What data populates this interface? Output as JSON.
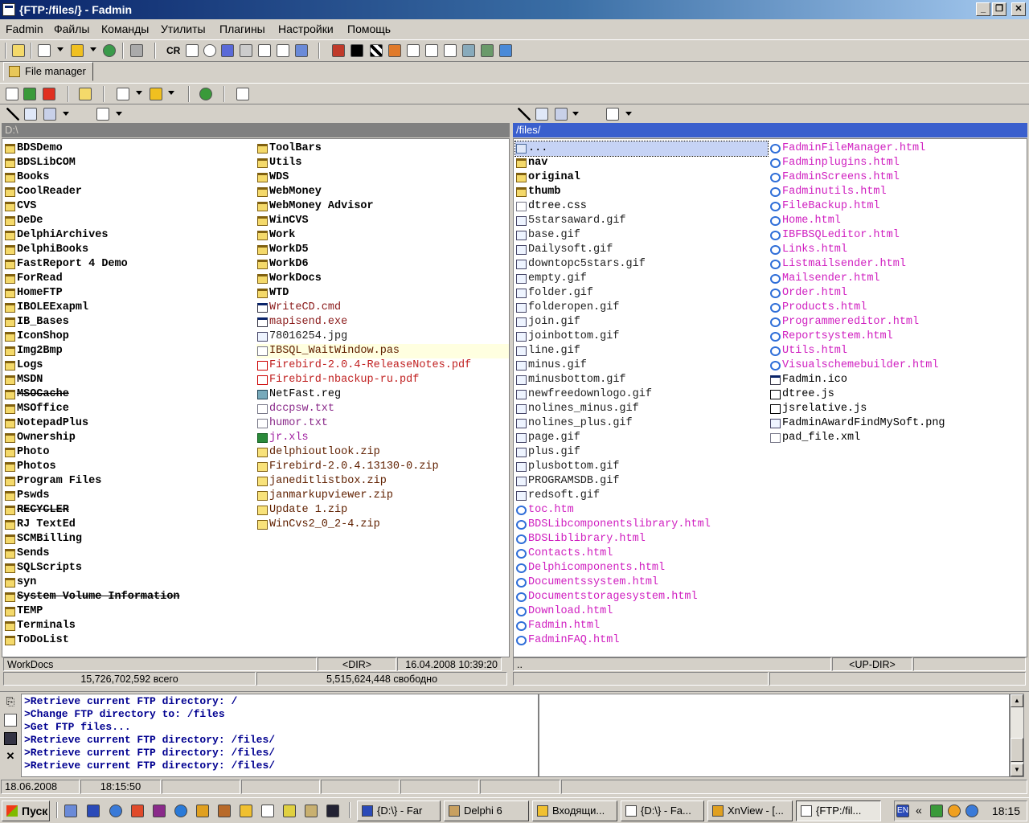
{
  "window": {
    "title": "{FTP:/files/} - Fadmin",
    "btn_min": "_",
    "btn_max": "❐",
    "btn_close": "✕"
  },
  "menu": [
    "Fadmin",
    "Файлы",
    "Команды",
    "Утилиты",
    "Плагины",
    "Настройки",
    "Помощь"
  ],
  "toolbar": {
    "cr_label": "CR"
  },
  "tab": {
    "label": "File manager"
  },
  "left": {
    "path": "D:\\",
    "col1": [
      {
        "n": "BDSDemo",
        "t": "dir"
      },
      {
        "n": "BDSLibCOM",
        "t": "dir"
      },
      {
        "n": "Books",
        "t": "dir"
      },
      {
        "n": "CoolReader",
        "t": "dir"
      },
      {
        "n": "CVS",
        "t": "dir"
      },
      {
        "n": "DeDe",
        "t": "dir"
      },
      {
        "n": "DelphiArchives",
        "t": "dir"
      },
      {
        "n": "DelphiBooks",
        "t": "dir"
      },
      {
        "n": "FastReport 4 Demo",
        "t": "dir"
      },
      {
        "n": "ForRead",
        "t": "dir"
      },
      {
        "n": "HomeFTP",
        "t": "dir"
      },
      {
        "n": "IBOLEExapml",
        "t": "dir"
      },
      {
        "n": "IB_Bases",
        "t": "dir"
      },
      {
        "n": "IconShop",
        "t": "dir"
      },
      {
        "n": "Img2Bmp",
        "t": "dir"
      },
      {
        "n": "Logs",
        "t": "dir"
      },
      {
        "n": "MSDN",
        "t": "dir"
      },
      {
        "n": "MSOCache",
        "t": "dir",
        "strike": true
      },
      {
        "n": "MSOffice",
        "t": "dir"
      },
      {
        "n": "NotepadPlus",
        "t": "dir"
      },
      {
        "n": "Ownership",
        "t": "dir"
      },
      {
        "n": "Photo",
        "t": "dir"
      },
      {
        "n": "Photos",
        "t": "dir"
      },
      {
        "n": "Program Files",
        "t": "dir"
      },
      {
        "n": "Pswds",
        "t": "dir"
      },
      {
        "n": "RECYCLER",
        "t": "dir",
        "strike": true
      },
      {
        "n": "RJ TextEd",
        "t": "dir"
      },
      {
        "n": "SCMBilling",
        "t": "dir"
      },
      {
        "n": "Sends",
        "t": "dir"
      },
      {
        "n": "SQLScripts",
        "t": "dir"
      },
      {
        "n": "syn",
        "t": "dir"
      },
      {
        "n": "System Volume Information",
        "t": "dir",
        "strike": true
      },
      {
        "n": "TEMP",
        "t": "dir"
      },
      {
        "n": "Terminals",
        "t": "dir"
      },
      {
        "n": "ToDoList",
        "t": "dir"
      }
    ],
    "col2": [
      {
        "n": "ToolBars",
        "t": "dir"
      },
      {
        "n": "Utils",
        "t": "dir"
      },
      {
        "n": "WDS",
        "t": "dir"
      },
      {
        "n": "WebMoney",
        "t": "dir"
      },
      {
        "n": "WebMoney Advisor",
        "t": "dir"
      },
      {
        "n": "WinCVS",
        "t": "dir"
      },
      {
        "n": "Work",
        "t": "dir"
      },
      {
        "n": "WorkD5",
        "t": "dir"
      },
      {
        "n": "WorkD6",
        "t": "dir"
      },
      {
        "n": "WorkDocs",
        "t": "dir"
      },
      {
        "n": "WTD",
        "t": "dir"
      },
      {
        "n": "WriteCD.cmd",
        "t": "exe"
      },
      {
        "n": "mapisend.exe",
        "t": "exe"
      },
      {
        "n": "78016254.jpg",
        "t": "img"
      },
      {
        "n": "IBSQL_WaitWindow.pas",
        "t": "pas",
        "cursor": true
      },
      {
        "n": "Firebird-2.0.4-ReleaseNotes.pdf",
        "t": "pdf"
      },
      {
        "n": "Firebird-nbackup-ru.pdf",
        "t": "pdf"
      },
      {
        "n": "NetFast.reg",
        "t": "reg"
      },
      {
        "n": "dccpsw.txt",
        "t": "txt"
      },
      {
        "n": "humor.txt",
        "t": "txt"
      },
      {
        "n": "jr.xls",
        "t": "xls"
      },
      {
        "n": "delphioutlook.zip",
        "t": "zip"
      },
      {
        "n": "Firebird-2.0.4.13130-0.zip",
        "t": "zip"
      },
      {
        "n": "janeditlistbox.zip",
        "t": "zip"
      },
      {
        "n": "janmarkupviewer.zip",
        "t": "zip"
      },
      {
        "n": "Update 1.zip",
        "t": "zip"
      },
      {
        "n": "WinCvs2_0_2-4.zip",
        "t": "zip"
      }
    ],
    "status": {
      "name": "WorkDocs",
      "type": "<DIR>",
      "date": "16.04.2008 10:39:20"
    },
    "total": "15,726,702,592 всего",
    "free": "5,515,624,448 свободно"
  },
  "right": {
    "path": "/files/",
    "col1": [
      {
        "n": "...",
        "t": "up",
        "cursor": true
      },
      {
        "n": "nav",
        "t": "dir"
      },
      {
        "n": "original",
        "t": "dir"
      },
      {
        "n": "thumb",
        "t": "dir"
      },
      {
        "n": "dtree.css",
        "t": "css"
      },
      {
        "n": "5starsaward.gif",
        "t": "img"
      },
      {
        "n": "base.gif",
        "t": "img"
      },
      {
        "n": "Dailysoft.gif",
        "t": "img"
      },
      {
        "n": "downtopc5stars.gif",
        "t": "img"
      },
      {
        "n": "empty.gif",
        "t": "img"
      },
      {
        "n": "folder.gif",
        "t": "img"
      },
      {
        "n": "folderopen.gif",
        "t": "img"
      },
      {
        "n": "join.gif",
        "t": "img"
      },
      {
        "n": "joinbottom.gif",
        "t": "img"
      },
      {
        "n": "line.gif",
        "t": "img"
      },
      {
        "n": "minus.gif",
        "t": "img"
      },
      {
        "n": "minusbottom.gif",
        "t": "img"
      },
      {
        "n": "newfreedownlogo.gif",
        "t": "img"
      },
      {
        "n": "nolines_minus.gif",
        "t": "img"
      },
      {
        "n": "nolines_plus.gif",
        "t": "img"
      },
      {
        "n": "page.gif",
        "t": "img"
      },
      {
        "n": "plus.gif",
        "t": "img"
      },
      {
        "n": "plusbottom.gif",
        "t": "img"
      },
      {
        "n": "PROGRAMSDB.gif",
        "t": "img"
      },
      {
        "n": "redsoft.gif",
        "t": "img"
      },
      {
        "n": "toc.htm",
        "t": "html"
      },
      {
        "n": "BDSLibcomponentslibrary.html",
        "t": "html"
      },
      {
        "n": "BDSLiblibrary.html",
        "t": "html"
      },
      {
        "n": "Contacts.html",
        "t": "html"
      },
      {
        "n": "Delphicomponents.html",
        "t": "html"
      },
      {
        "n": "Documentssystem.html",
        "t": "html"
      },
      {
        "n": "Documentstoragesystem.html",
        "t": "html"
      },
      {
        "n": "Download.html",
        "t": "html"
      },
      {
        "n": "Fadmin.html",
        "t": "html"
      },
      {
        "n": "FadminFAQ.html",
        "t": "html"
      }
    ],
    "col2": [
      {
        "n": "FadminFileManager.html",
        "t": "html"
      },
      {
        "n": "Fadminplugins.html",
        "t": "html"
      },
      {
        "n": "FadminScreens.html",
        "t": "html"
      },
      {
        "n": "Fadminutils.html",
        "t": "html"
      },
      {
        "n": "FileBackup.html",
        "t": "html"
      },
      {
        "n": "Home.html",
        "t": "html"
      },
      {
        "n": "IBFBSQLeditor.html",
        "t": "html"
      },
      {
        "n": "Links.html",
        "t": "html"
      },
      {
        "n": "Listmailsender.html",
        "t": "html"
      },
      {
        "n": "Mailsender.html",
        "t": "html"
      },
      {
        "n": "Order.html",
        "t": "html"
      },
      {
        "n": "Products.html",
        "t": "html"
      },
      {
        "n": "Programmereditor.html",
        "t": "html"
      },
      {
        "n": "Reportsystem.html",
        "t": "html"
      },
      {
        "n": "Utils.html",
        "t": "html"
      },
      {
        "n": "Visualschemebuilder.html",
        "t": "html"
      },
      {
        "n": "Fadmin.ico",
        "t": "ico"
      },
      {
        "n": "dtree.js",
        "t": "js"
      },
      {
        "n": "jsrelative.js",
        "t": "js"
      },
      {
        "n": "FadminAwardFindMySoft.png",
        "t": "png"
      },
      {
        "n": "pad_file.xml",
        "t": "xml"
      }
    ],
    "status": {
      "name": "..",
      "type": "<UP-DIR>"
    }
  },
  "log": [
    ">Retrieve current FTP directory: /",
    ">Change FTP directory to: /files",
    ">Get FTP files...",
    ">Retrieve current FTP directory: /files/",
    ">Retrieve current FTP directory: /files/",
    ">Retrieve current FTP directory: /files/"
  ],
  "status": {
    "date": "18.06.2008",
    "time": "18:15:50"
  },
  "taskbar": {
    "start": "Пуск",
    "tasks": [
      "{D:\\} - Far",
      "Delphi 6",
      "Входящи...",
      "{D:\\} - Fa...",
      "XnView - [...",
      "{FTP:/fil..."
    ],
    "lang": "EN",
    "clock": "18:15"
  },
  "colors": {
    "title_start": "#0a246a",
    "path_active": "#3a5fcd",
    "path_inactive": "#808080",
    "html_file": "#d020c0",
    "log_text": "#000090"
  }
}
